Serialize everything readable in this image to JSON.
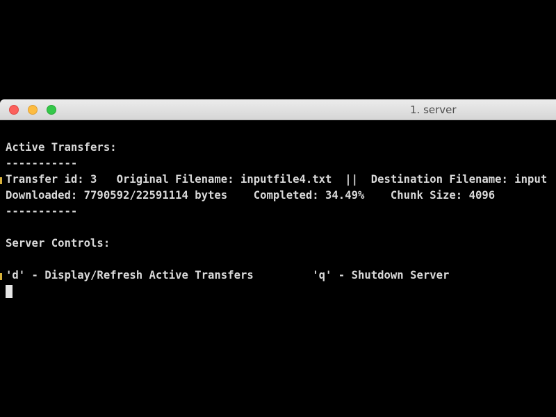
{
  "window": {
    "title": "1. server"
  },
  "terminal": {
    "active_heading": "Active Transfers:",
    "separator_top": "-----------",
    "transfer_line": "Transfer id: 3   Original Filename: inputfile4.txt  ||  Destination Filename: input",
    "download_line": "Downloaded: 7790592/22591114 bytes    Completed: 34.49%    Chunk Size: 4096",
    "separator_bottom": "-----------",
    "controls_heading": "Server Controls:",
    "controls_line": "'d' - Display/Refresh Active Transfers         'q' - Shutdown Server"
  },
  "colors": {
    "background": "#000000",
    "text": "#d9d9d9",
    "marker": "#d8b23a"
  }
}
